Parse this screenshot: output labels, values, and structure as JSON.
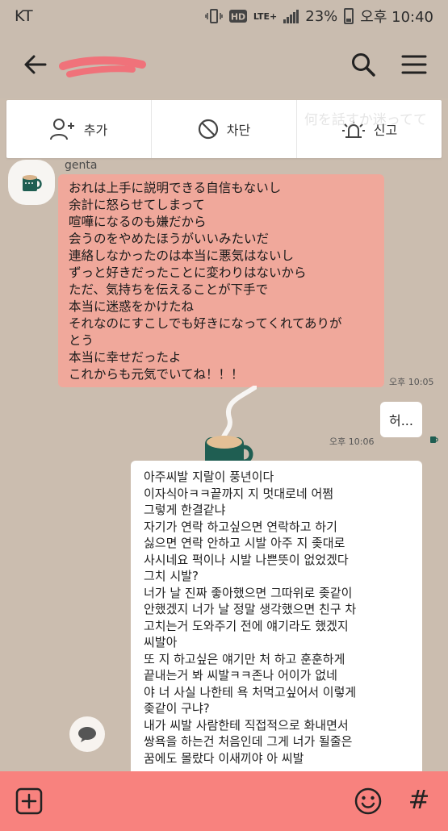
{
  "status_bar": {
    "carrier": "KT",
    "battery": "23%",
    "time": "오후 10:40",
    "network": "LTE+"
  },
  "header": {
    "title_redacted": true,
    "back_icon": "arrow-left-icon",
    "search_icon": "search-icon",
    "menu_icon": "hamburger-icon"
  },
  "actions": {
    "add_label": "추가",
    "block_label": "차단",
    "report_label": "신고",
    "ghost_text": "何を話すか迷ってて"
  },
  "messages": {
    "sender_name": "genta",
    "first_lines": [
      "おれは上手に説明できる自信もないし",
      "余計に怒らせてしまって",
      "喧嘩になるのも嫌だから",
      "会うのをやめたほうがいいみたいだ",
      "連絡しなかったのは本当に悪気はないし",
      "ずっと好きだったことに変わりはないから",
      "ただ、気持ちを伝えることが下手で",
      "本当に迷惑をかけたね",
      "それなのにすこしでも好きになってくれてありが",
      "とう",
      "本当に幸せだったよ",
      "これからも元気でいてね！！！"
    ],
    "first_time": "오후 10:05",
    "reply": "허...",
    "reply_time": "오후 10:06",
    "second_lines": [
      "아주씨발 지랄이 풍년이다",
      "이자식아ㅋㅋ끝까지 지 멋대로네 어쩜",
      "그렇게 한결같냐",
      "자기가 연락 하고싶으면 연락하고 하기",
      "싫으면 연락 안하고 시발 아주 지 좆대로",
      "사시네요 퍽이나 시발 나쁜뜻이 없었겠다",
      "그치 시발?",
      "너가 날 진짜 좋아했으면 그따위로 좆같이",
      "안했겠지 너가 날 정말 생각했으면 친구 차",
      "고치는거 도와주기 전에 얘기라도 했겠지",
      "씨발아",
      "또 지 하고싶은 얘기만 처 하고 훈훈하게",
      "끝내는거 봐 씨발ㅋㅋ존나 어이가 없네",
      "야 너 사실 나한테 욕 처먹고싶어서 이렇게",
      "좆같이 구냐?",
      "내가 씨발 사람한테 직접적으로 화내면서",
      "쌍욕을 하는건 처음인데 그게 너가 될줄은",
      "꿈에도 몰랐다 이새끼야 아 씨발"
    ]
  },
  "bottom_bar": {
    "plus_icon": "plus-square-icon",
    "emoji_icon": "emoji-icon",
    "hash_label": "#"
  },
  "colors": {
    "background": "#cbbdaf",
    "pink_bubble": "#f0a89b",
    "bottom_bar": "#f8827e",
    "scribble": "#f0727a"
  }
}
